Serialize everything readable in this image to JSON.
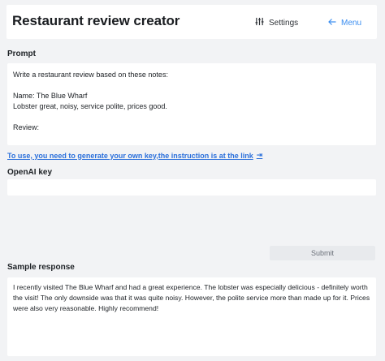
{
  "header": {
    "title": "Restaurant review creator",
    "settings_label": "Settings",
    "menu_label": "Menu",
    "settings_icon": "sliders-icon",
    "menu_icon": "arrow-left-icon",
    "accent_color": "#3b8ef0"
  },
  "prompt": {
    "label": "Prompt",
    "text": "Write a restaurant review based on these notes:\n\nName: The Blue Wharf\nLobster great, noisy, service polite, prices good.\n\nReview:"
  },
  "api_key_link": {
    "text": "To use, you need to generate your own key,the instruction is at the link",
    "icon": "external-link-icon"
  },
  "openai_key": {
    "label": "OpenAI key",
    "value": ""
  },
  "submit": {
    "label": "Submit"
  },
  "sample_response": {
    "label": "Sample response",
    "text": "I recently visited The Blue Wharf and had a great experience. The lobster was especially delicious - definitely worth the visit! The only downside was that it was quite noisy. However, the polite service more than made up for it. Prices were also very reasonable. Highly recommend!"
  }
}
